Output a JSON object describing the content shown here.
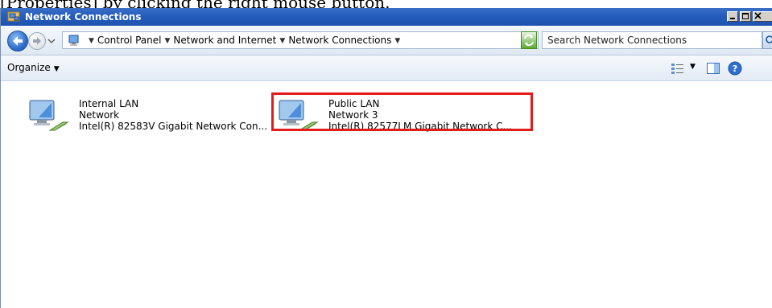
{
  "caption": "[Properties] by clicking the right mouse button.",
  "window": {
    "title": "Network Connections"
  },
  "address": {
    "breadcrumbs": [
      "Control Panel",
      "Network and Internet",
      "Network Connections"
    ]
  },
  "search": {
    "placeholder": "Search Network Connections"
  },
  "toolbar": {
    "organize_label": "Organize"
  },
  "connections": [
    {
      "name": "Internal LAN",
      "network": "Network",
      "adapter": "Intel(R) 82583V Gigabit Network Con..."
    },
    {
      "name": "Public LAN",
      "network": "Network  3",
      "adapter": "Intel(R) 82577LM Gigabit Network C..."
    }
  ],
  "icons": {
    "title": "network-folder-icon",
    "back": "back-arrow-icon",
    "forward": "forward-arrow-icon",
    "refresh": "refresh-icon",
    "search": "search-icon",
    "views": "views-icon",
    "preview_pane": "preview-pane-icon",
    "help": "help-icon",
    "connection": "network-adapter-icon"
  },
  "colors": {
    "titlebar": "#245dbd",
    "highlight_frame": "#e41b1b"
  }
}
